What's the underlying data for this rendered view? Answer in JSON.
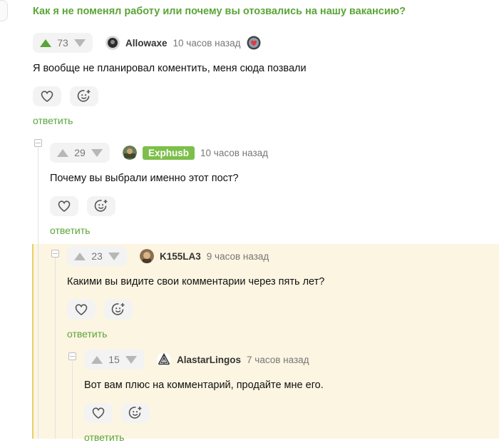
{
  "post": {
    "title": "Как я не поменял работу или почему вы отозвались на нашу вакансию?"
  },
  "comments": [
    {
      "rating": "73",
      "author": "Allowaxe",
      "time": "10 часов назад",
      "text": "Я вообще не планировал коментить, меня сюда позвали",
      "reply_label": "ответить"
    },
    {
      "rating": "29",
      "author": "Exphusb",
      "time": "10 часов назад",
      "text": "Почему вы выбрали именно этот пост?",
      "reply_label": "ответить"
    },
    {
      "rating": "23",
      "author": "K155LA3",
      "time": "9 часов назад",
      "text": "Какими вы видите свои комментарии через пять лет?",
      "reply_label": "ответить"
    },
    {
      "rating": "15",
      "author": "AlastarLingos",
      "time": "7 часов назад",
      "text": "Вот вам плюс на комментарий, продайте мне его.",
      "reply_label": "ответить"
    }
  ],
  "icons": {
    "upvote": "arrow-up-icon",
    "downvote": "arrow-down-icon",
    "like": "heart-icon",
    "reaction": "smiley-plus-icon",
    "collapse": "minus-box-icon"
  },
  "colors": {
    "accent_green": "#5aa537",
    "badge_green": "#7cbf4a",
    "highlight_bg": "#fcf5e2",
    "highlight_border": "#e9cf62",
    "button_bg": "#f3f3f3"
  }
}
